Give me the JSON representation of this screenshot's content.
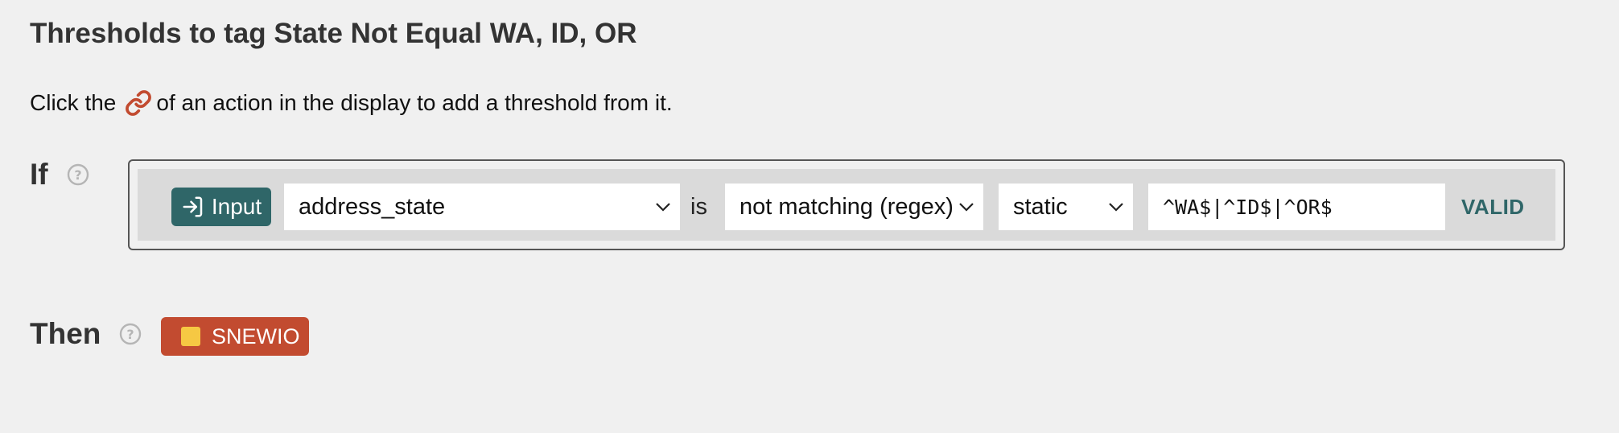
{
  "title": "Thresholds to tag State Not Equal WA, ID, OR",
  "hint": {
    "before": "Click the",
    "after": "of an action in the display to add a threshold from it.",
    "icon": "link-icon"
  },
  "condition": {
    "label": "If",
    "help_icon": "help-circle-icon",
    "source_badge": "Input",
    "source_icon": "sign-in-icon",
    "field_select": "address_state",
    "connector": "is",
    "operator_select": "not matching (regex)",
    "value_type_select": "static",
    "value": "^WA$|^ID$|^OR$",
    "status": "VALID"
  },
  "action": {
    "label": "Then",
    "help_icon": "help-circle-icon",
    "tag_name": "SNEWIO"
  },
  "colors": {
    "background": "#f0f0f0",
    "accent_teal": "#2f6668",
    "tag_red": "#c24b30",
    "tag_swatch": "#f6c843",
    "link_icon": "#c24b30"
  }
}
